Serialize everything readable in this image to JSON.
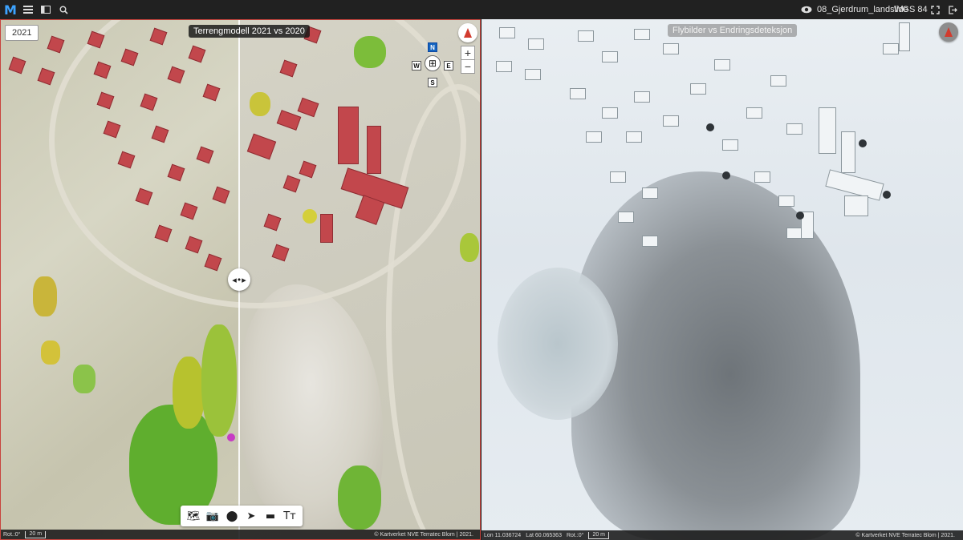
{
  "topbar": {
    "logo": "M",
    "project_name": "08_Gjerdrum_landslide",
    "crs": "WGS 84"
  },
  "icons": {
    "logo": "app-logo-icon",
    "menu": "menu-icon",
    "panel": "panel-toggle-icon",
    "search": "search-icon",
    "visibility": "eye-icon",
    "fit": "fit-extent-icon",
    "exit": "exit-icon"
  },
  "left_map": {
    "year_chip": "2021",
    "title": "Terrengmodell 2021 vs 2020",
    "nav": {
      "n": "N",
      "w": "W",
      "e": "E",
      "s": "S"
    },
    "zoom_in": "+",
    "zoom_out": "−",
    "status": {
      "rotation": "Rot.:0°",
      "scale": "20 m",
      "attribution": "© Kartverket NVE Terratec Blom | 2021."
    }
  },
  "right_map": {
    "title": "Flybilder vs Endringsdeteksjon",
    "status": {
      "lon": "Lon 11.036724",
      "lat": "Lat 60.065363",
      "rotation": "Rot.:0°",
      "scale": "20 m",
      "attribution": "© Kartverket NVE Terratec Blom | 2021."
    }
  },
  "toolbar": {
    "tools": [
      {
        "name": "map-icon",
        "glyph": "🗺"
      },
      {
        "name": "camera-icon",
        "glyph": "📷"
      },
      {
        "name": "pin-icon",
        "glyph": "⬤"
      },
      {
        "name": "cursor-icon",
        "glyph": "➤"
      },
      {
        "name": "ruler-icon",
        "glyph": "▬"
      },
      {
        "name": "text-icon",
        "glyph": "Tт"
      }
    ]
  },
  "colors": {
    "accent": "#3da3ff",
    "panel_border": "#c8433d",
    "roof_red": "#c2474c"
  }
}
